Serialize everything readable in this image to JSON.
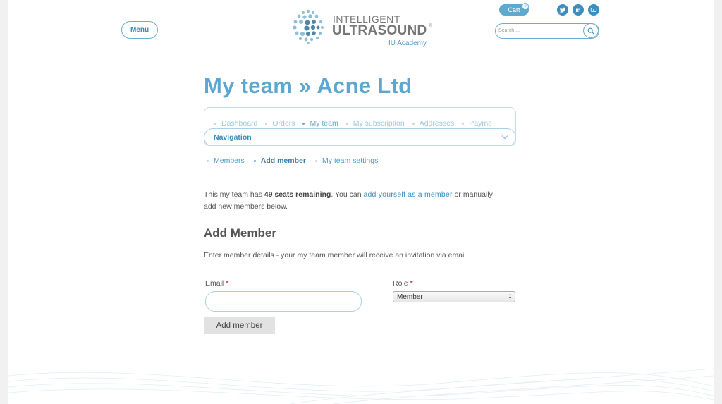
{
  "header": {
    "menu_label": "Menu",
    "logo": {
      "line1": "INTELLIGENT",
      "line2": "ULTRASOUND",
      "registered": "®",
      "line3": "IU Academy"
    },
    "cart": {
      "label": "Cart",
      "count": "0"
    },
    "social": [
      {
        "name": "twitter",
        "icon": "twitter-icon"
      },
      {
        "name": "linkedin",
        "icon": "linkedin-icon",
        "text": "in"
      },
      {
        "name": "youtube",
        "icon": "youtube-icon"
      }
    ],
    "search": {
      "placeholder": "Search ...",
      "icon": "search-icon"
    }
  },
  "page": {
    "title": "My team » Acne Ltd",
    "nav": {
      "items": [
        "Dashboard",
        "Orders",
        "My team",
        "My subscription",
        "Addresses",
        "Payme"
      ],
      "active_index": 2,
      "toggle_label": "Navigation"
    },
    "sub_nav": {
      "items": [
        "Members",
        "Add member",
        "My team settings"
      ],
      "active_index": 1
    },
    "intro": {
      "before": "This my team has ",
      "seats": "49 seats remaining",
      "middle": ". You can ",
      "link": "add yourself as a member",
      "after": " or manually add new members below."
    },
    "form": {
      "title": "Add Member",
      "description": "Enter member details - your my team member will receive an invitation via email.",
      "email_label": "Email",
      "required_mark": "*",
      "email_value": "",
      "role_label": "Role",
      "role_value": "Member",
      "submit_label": "Add member"
    }
  },
  "colors": {
    "brand_blue": "#5ba7cf",
    "link_blue": "#3f90bf",
    "required_red": "#d43a3a"
  }
}
